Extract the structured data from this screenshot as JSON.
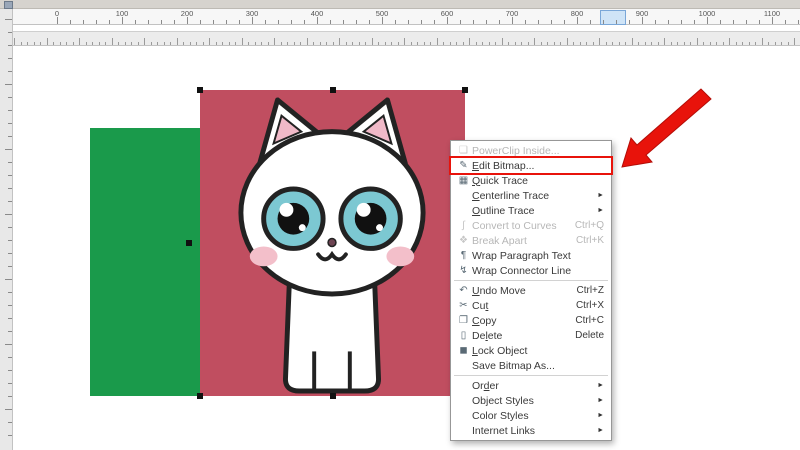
{
  "rulers": {
    "horizontal_numbers": [
      "0",
      "100",
      "200",
      "300",
      "400",
      "500",
      "600",
      "700",
      "800",
      "900",
      "1000",
      "1100"
    ]
  },
  "canvas_objects": {
    "green_rectangle": {
      "color": "#1a9a4b"
    },
    "bitmap": {
      "background_color": "#c04e60",
      "cat_body_color": "#ffffff",
      "cat_outline_color": "#222222",
      "cat_eye_color": "#7cc8d2",
      "cat_inner_ear_color": "#f0b9c8",
      "cat_cheek_color": "#f3bfca"
    }
  },
  "annotation_arrow": {
    "color": "#e8130b"
  },
  "context_menu": {
    "items": [
      {
        "label": "PowerClip Inside...",
        "icon": "powerclip-icon",
        "disabled": true
      },
      {
        "label": "Edit Bitmap...",
        "mnemonic": "E",
        "icon": "edit-bitmap-icon",
        "highlighted": true
      },
      {
        "label": "Quick Trace",
        "mnemonic": "Q",
        "icon": "quick-trace-icon"
      },
      {
        "label": "Centerline Trace",
        "mnemonic": "C",
        "submenu": true
      },
      {
        "label": "Outline Trace",
        "mnemonic": "O",
        "submenu": true
      },
      {
        "label": "Convert to Curves",
        "icon": "convert-curves-icon",
        "shortcut": "Ctrl+Q",
        "disabled": true
      },
      {
        "label": "Break Apart",
        "icon": "break-apart-icon",
        "shortcut": "Ctrl+K",
        "disabled": true
      },
      {
        "label": "Wrap Paragraph Text",
        "icon": "wrap-text-icon"
      },
      {
        "label": "Wrap Connector Line",
        "icon": "wrap-connector-icon"
      },
      {
        "separator": true
      },
      {
        "label": "Undo Move",
        "mnemonic": "U",
        "icon": "undo-icon",
        "shortcut": "Ctrl+Z"
      },
      {
        "label": "Cut",
        "mnemonic": "t",
        "icon": "cut-icon",
        "shortcut": "Ctrl+X"
      },
      {
        "label": "Copy",
        "mnemonic": "C",
        "icon": "copy-icon",
        "shortcut": "Ctrl+C"
      },
      {
        "label": "Delete",
        "mnemonic": "l",
        "icon": "delete-icon",
        "shortcut": "Delete"
      },
      {
        "label": "Lock Object",
        "mnemonic": "L",
        "icon": "lock-icon"
      },
      {
        "label": "Save Bitmap As..."
      },
      {
        "separator": true
      },
      {
        "label": "Order",
        "mnemonic": "d",
        "submenu": true
      },
      {
        "label": "Object Styles",
        "submenu": true
      },
      {
        "label": "Color Styles",
        "submenu": true
      },
      {
        "label": "Internet Links",
        "submenu": true
      }
    ]
  }
}
